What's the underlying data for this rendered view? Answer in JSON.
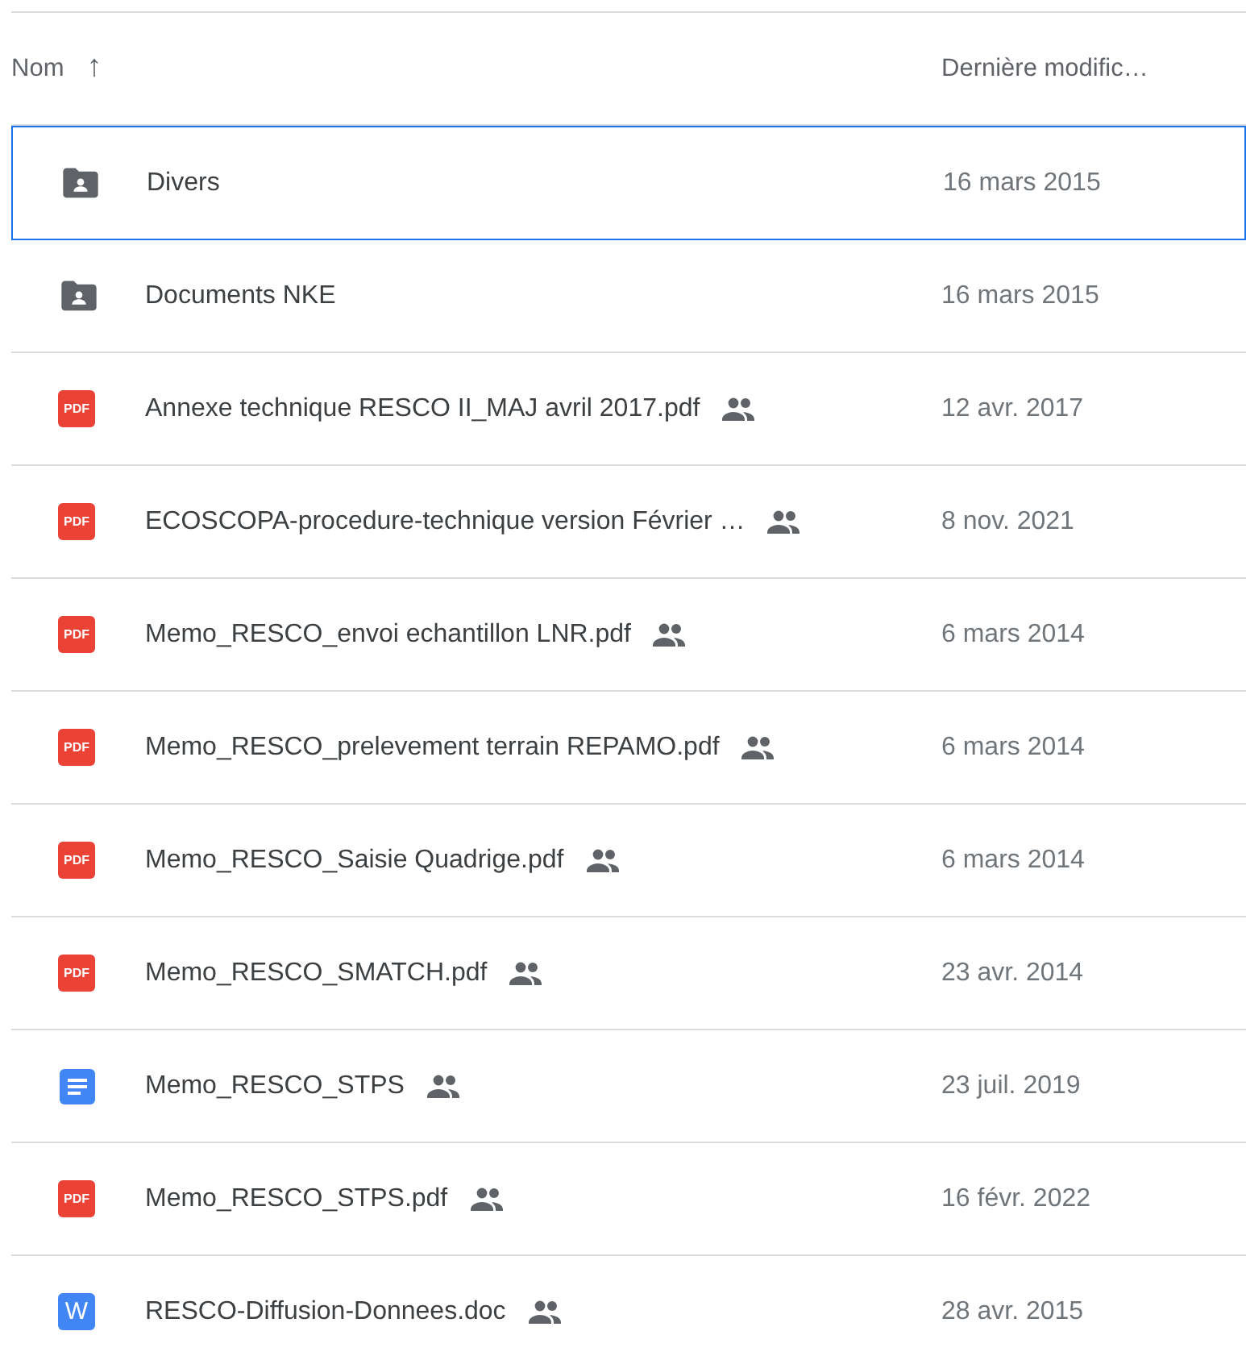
{
  "header": {
    "name_label": "Nom",
    "sort_arrow": "↑",
    "date_label": "Dernière modific…"
  },
  "files": [
    {
      "kind": "folder",
      "name": "Divers",
      "shared": false,
      "selected": true,
      "modified": "16 mars 2015"
    },
    {
      "kind": "folder",
      "name": "Documents NKE",
      "shared": false,
      "selected": false,
      "modified": "16 mars 2015"
    },
    {
      "kind": "pdf",
      "icon_text": "PDF",
      "name": "Annexe technique RESCO II_MAJ avril 2017.pdf",
      "shared": true,
      "selected": false,
      "modified": "12 avr. 2017"
    },
    {
      "kind": "pdf",
      "icon_text": "PDF",
      "name": "ECOSCOPA-procedure-technique version Février …",
      "shared": true,
      "selected": false,
      "modified": "8 nov. 2021"
    },
    {
      "kind": "pdf",
      "icon_text": "PDF",
      "name": "Memo_RESCO_envoi echantillon LNR.pdf",
      "shared": true,
      "selected": false,
      "modified": "6 mars 2014"
    },
    {
      "kind": "pdf",
      "icon_text": "PDF",
      "name": "Memo_RESCO_prelevement terrain REPAMO.pdf",
      "shared": true,
      "selected": false,
      "modified": "6 mars 2014"
    },
    {
      "kind": "pdf",
      "icon_text": "PDF",
      "name": "Memo_RESCO_Saisie Quadrige.pdf",
      "shared": true,
      "selected": false,
      "modified": "6 mars 2014"
    },
    {
      "kind": "pdf",
      "icon_text": "PDF",
      "name": "Memo_RESCO_SMATCH.pdf",
      "shared": true,
      "selected": false,
      "modified": "23 avr. 2014"
    },
    {
      "kind": "gdoc",
      "name": "Memo_RESCO_STPS",
      "shared": true,
      "selected": false,
      "modified": "23 juil. 2019"
    },
    {
      "kind": "pdf",
      "icon_text": "PDF",
      "name": "Memo_RESCO_STPS.pdf",
      "shared": true,
      "selected": false,
      "modified": "16 févr. 2022"
    },
    {
      "kind": "word",
      "icon_text": "W",
      "name": "RESCO-Diffusion-Donnees.doc",
      "shared": true,
      "selected": false,
      "modified": "28 avr. 2015"
    }
  ]
}
